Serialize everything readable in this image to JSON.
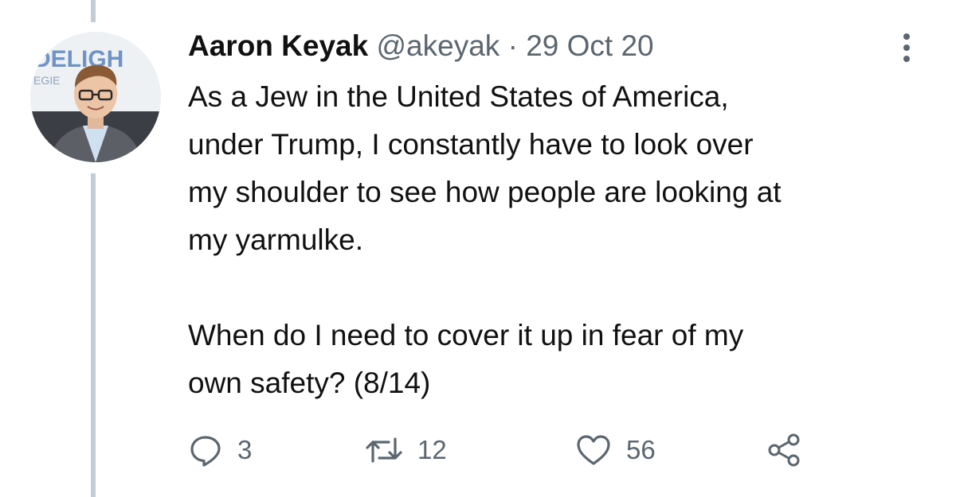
{
  "tweet": {
    "author": {
      "display_name": "Aaron Keyak",
      "handle": "@akeyak",
      "separator": "·",
      "date": "29 Oct 20",
      "avatar_banner_text": "DELIGH",
      "avatar_banner_subtext": "EGIE"
    },
    "body": {
      "paragraph_1": "As a Jew in the United States of America,\nunder Trump, I constantly have to look over\nmy shoulder to see how people are looking at\nmy yarmulke.",
      "paragraph_2": "When do I need to cover it up in fear of my\nown safety? (8/14)"
    },
    "actions": {
      "reply_count": "3",
      "retweet_count": "12",
      "like_count": "56"
    }
  },
  "colors": {
    "text": "#111111",
    "secondary_text": "#5b6670",
    "thread_line": "#c4cdd4",
    "background": "#ffffff"
  },
  "icons": [
    "more-vertical-icon",
    "reply-icon",
    "retweet-icon",
    "like-icon",
    "share-icon"
  ]
}
